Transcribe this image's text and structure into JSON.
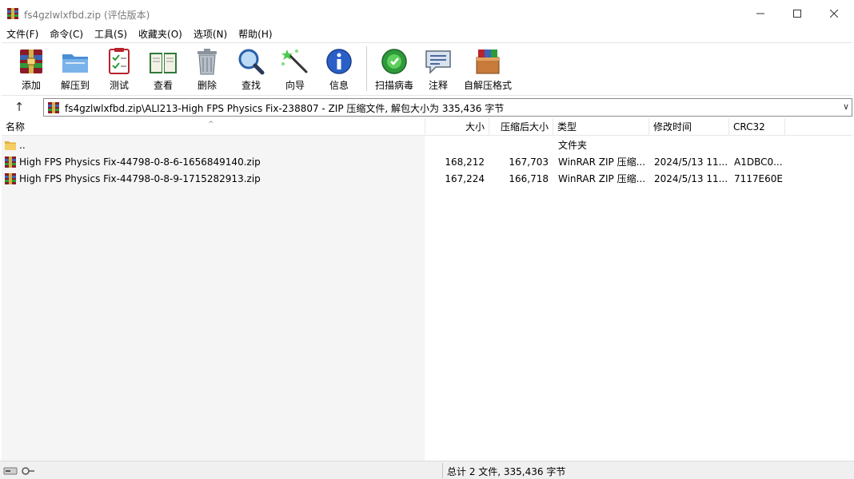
{
  "window": {
    "title": "fs4gzlwlxfbd.zip (评估版本)"
  },
  "menu": [
    {
      "label": "文件(F)"
    },
    {
      "label": "命令(C)"
    },
    {
      "label": "工具(S)"
    },
    {
      "label": "收藏夹(O)"
    },
    {
      "label": "选项(N)"
    },
    {
      "label": "帮助(H)"
    }
  ],
  "toolbar": [
    {
      "label": "添加",
      "icon": "add-archive-icon"
    },
    {
      "label": "解压到",
      "icon": "extract-to-icon"
    },
    {
      "label": "测试",
      "icon": "test-icon"
    },
    {
      "label": "查看",
      "icon": "view-book-icon"
    },
    {
      "label": "删除",
      "icon": "trash-icon"
    },
    {
      "label": "查找",
      "icon": "magnifier-icon"
    },
    {
      "label": "向导",
      "icon": "wizard-wand-icon"
    },
    {
      "label": "信息",
      "icon": "info-icon"
    },
    {
      "label": "扫描病毒",
      "icon": "virus-scan-icon"
    },
    {
      "label": "注释",
      "icon": "comment-icon"
    },
    {
      "label": "自解压格式",
      "icon": "sfx-box-icon"
    }
  ],
  "address": {
    "path": "fs4gzlwlxfbd.zip\\ALI213-High FPS Physics Fix-238807 - ZIP 压缩文件, 解包大小为 335,436 字节"
  },
  "columns": {
    "name": "名称",
    "size": "大小",
    "packed": "压缩后大小",
    "type": "类型",
    "modified": "修改时间",
    "crc": "CRC32"
  },
  "files": [
    {
      "name": "..",
      "size": "",
      "packed": "",
      "type": "文件夹",
      "modified": "",
      "crc": "",
      "icon": "folder-icon"
    },
    {
      "name": "High FPS Physics Fix-44798-0-8-6-1656849140.zip",
      "size": "168,212",
      "packed": "167,703",
      "type": "WinRAR ZIP 压缩...",
      "modified": "2024/5/13 11...",
      "crc": "A1DBC0...",
      "icon": "zip-archive-icon"
    },
    {
      "name": "High FPS Physics Fix-44798-0-8-9-1715282913.zip",
      "size": "167,224",
      "packed": "166,718",
      "type": "WinRAR ZIP 压缩...",
      "modified": "2024/5/13 11...",
      "crc": "7117E60E",
      "icon": "zip-archive-icon"
    }
  ],
  "status": {
    "summary": "总计 2 文件, 335,436 字节"
  },
  "colors": {
    "accent": "#1f6fc1",
    "folder": "#f1c453",
    "winrar_red": "#b8232c"
  }
}
